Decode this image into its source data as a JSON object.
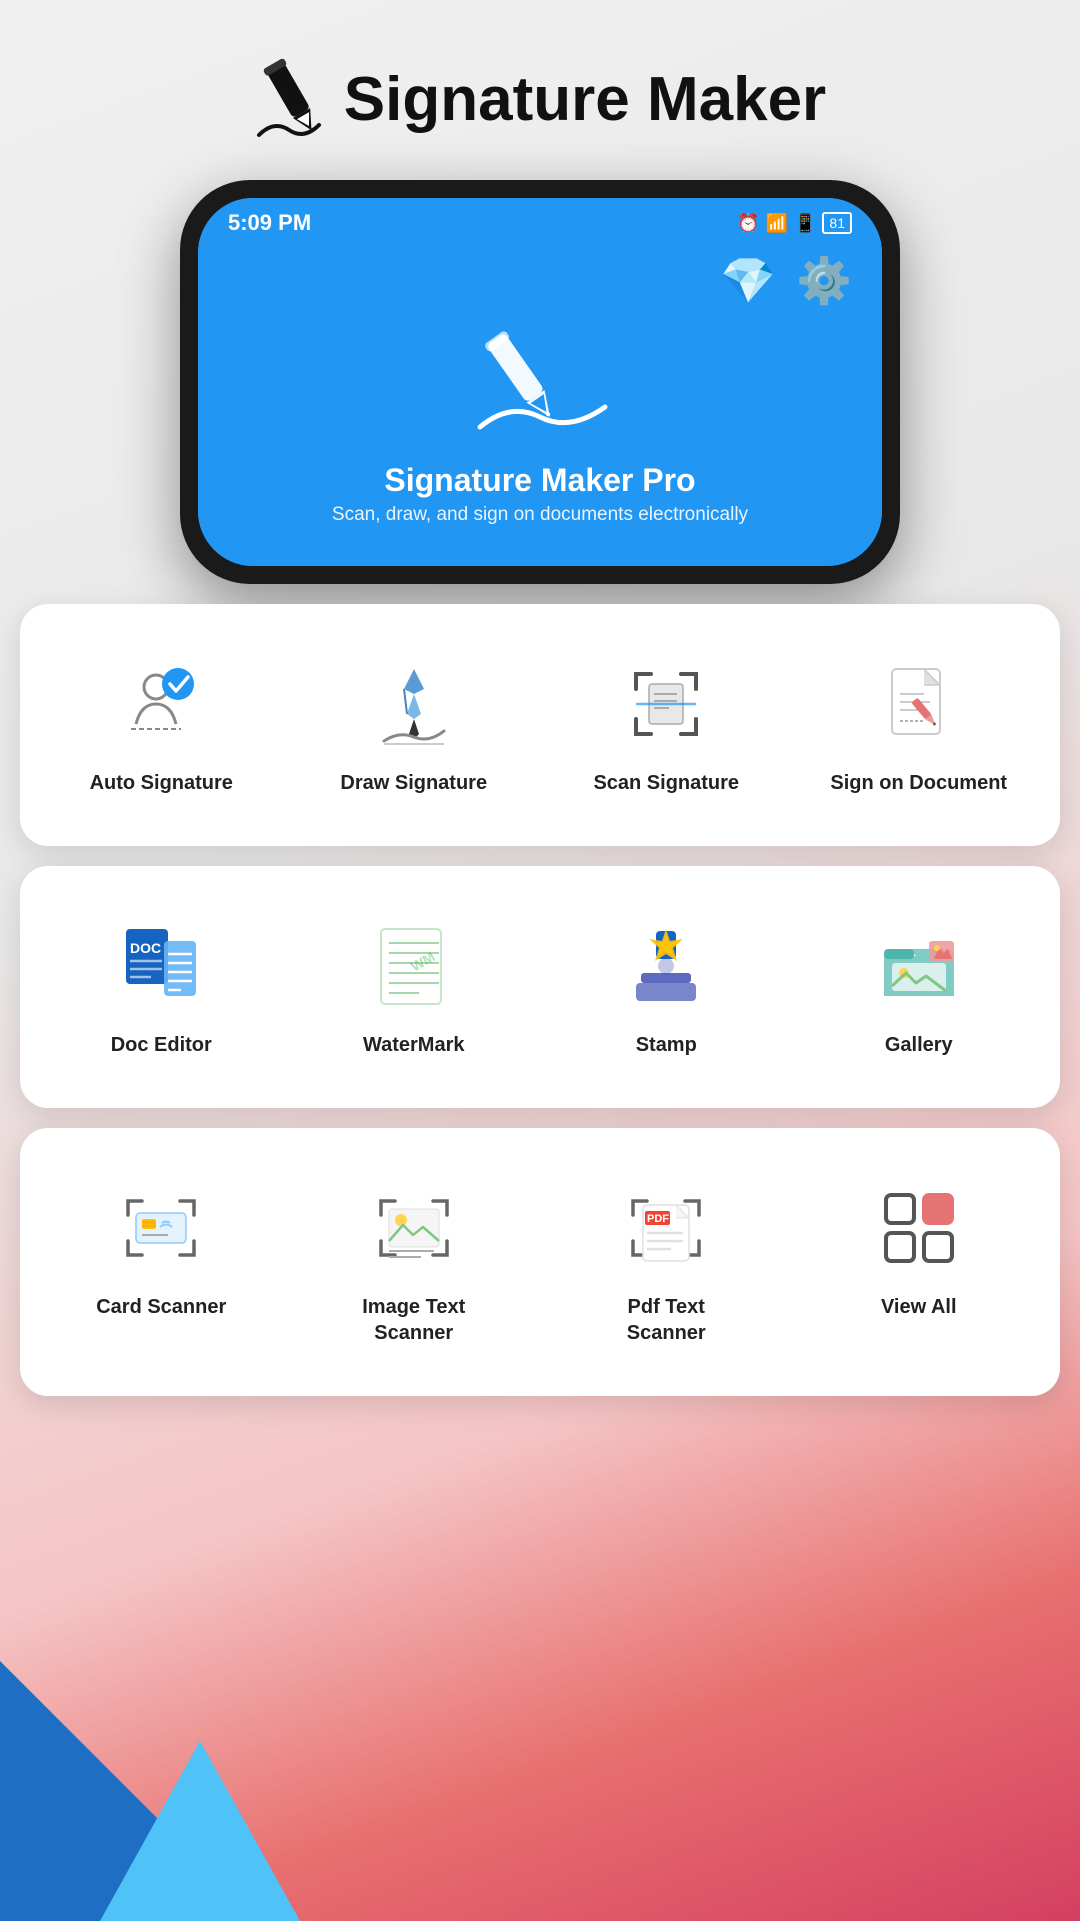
{
  "header": {
    "title": "Signature Maker"
  },
  "phone": {
    "status_time": "5:09 PM",
    "app_name": "Signature Maker Pro",
    "app_subtitle": "Scan, draw,  and sign on documents electronically"
  },
  "row1": {
    "items": [
      {
        "id": "auto-signature",
        "label": "Auto Signature"
      },
      {
        "id": "draw-signature",
        "label": "Draw Signature"
      },
      {
        "id": "scan-signature",
        "label": "Scan Signature"
      },
      {
        "id": "sign-on-document",
        "label": "Sign on Document"
      }
    ]
  },
  "row2": {
    "items": [
      {
        "id": "doc-editor",
        "label": "Doc Editor"
      },
      {
        "id": "watermark",
        "label": "WaterMark"
      },
      {
        "id": "stamp",
        "label": "Stamp"
      },
      {
        "id": "gallery",
        "label": "Gallery"
      }
    ]
  },
  "row3": {
    "items": [
      {
        "id": "card-scanner",
        "label": "Card Scanner"
      },
      {
        "id": "image-text-scanner",
        "label": "Image Text\nScanner"
      },
      {
        "id": "pdf-text-scanner",
        "label": "Pdf Text\nScanner"
      },
      {
        "id": "view-all",
        "label": "View All"
      }
    ]
  }
}
